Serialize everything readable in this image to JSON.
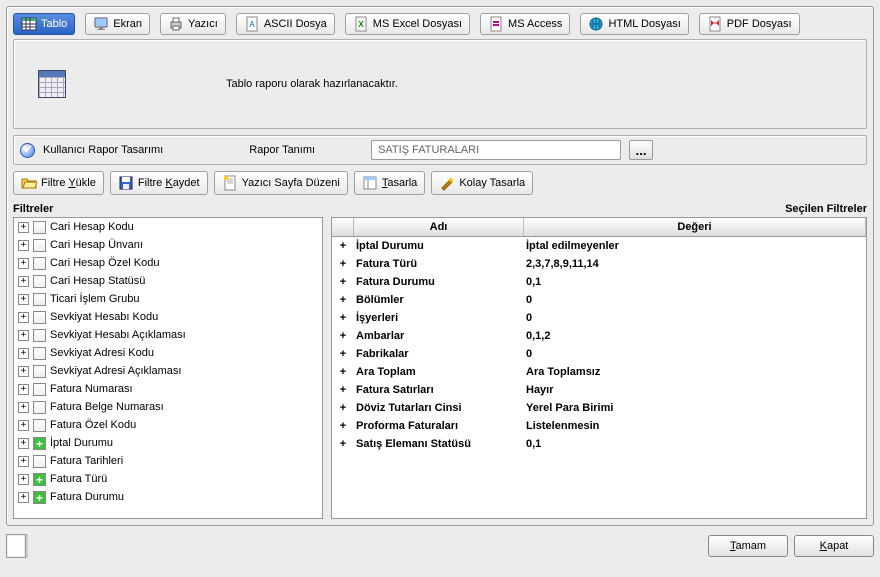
{
  "top_toolbar": [
    {
      "label": "Tablo",
      "active": true
    },
    {
      "label": "Ekran"
    },
    {
      "label": "Yazıcı"
    },
    {
      "label": "ASCII Dosya"
    },
    {
      "label": "MS Excel Dosyası"
    },
    {
      "label": "MS Access"
    },
    {
      "label": "HTML Dosyası"
    },
    {
      "label": "PDF Dosyası"
    }
  ],
  "description": "Tablo raporu olarak hazırlanacaktır.",
  "rapor": {
    "design_label": "Kullanıcı Rapor Tasarımı",
    "def_label": "Rapor Tanımı",
    "def_value": "SATIŞ FATURALARI"
  },
  "toolbar2": [
    {
      "label": "Filtre Yükle"
    },
    {
      "label": "Filtre Kaydet"
    },
    {
      "label": "Yazıcı Sayfa Düzeni"
    },
    {
      "label": "Tasarla"
    },
    {
      "label": "Kolay Tasarla"
    }
  ],
  "left_panel_title": "Filtreler",
  "right_panel_title": "Seçilen Filtreler",
  "right_header_name": "Adı",
  "right_header_val": "Değeri",
  "filters": [
    {
      "name": "Cari Hesap Kodu",
      "checked": false
    },
    {
      "name": "Cari Hesap Ünvanı",
      "checked": false
    },
    {
      "name": "Cari Hesap Özel Kodu",
      "checked": false
    },
    {
      "name": "Cari Hesap Statüsü",
      "checked": false
    },
    {
      "name": "Ticari İşlem Grubu",
      "checked": false
    },
    {
      "name": "Sevkiyat Hesabı Kodu",
      "checked": false
    },
    {
      "name": "Sevkiyat Hesabı Açıklaması",
      "checked": false
    },
    {
      "name": "Sevkiyat Adresi Kodu",
      "checked": false
    },
    {
      "name": "Sevkiyat Adresi Açıklaması",
      "checked": false
    },
    {
      "name": "Fatura Numarası",
      "checked": false
    },
    {
      "name": "Fatura Belge Numarası",
      "checked": false
    },
    {
      "name": "Fatura Özel Kodu",
      "checked": false
    },
    {
      "name": "İptal Durumu",
      "checked": true
    },
    {
      "name": "Fatura Tarihleri",
      "checked": false
    },
    {
      "name": "Fatura Türü",
      "checked": true
    },
    {
      "name": "Fatura Durumu",
      "checked": true
    }
  ],
  "selected": [
    {
      "name": "İptal Durumu",
      "value": "İptal edilmeyenler"
    },
    {
      "name": "Fatura Türü",
      "value": "2,3,7,8,9,11,14"
    },
    {
      "name": "Fatura Durumu",
      "value": "0,1"
    },
    {
      "name": "Bölümler",
      "value": "0"
    },
    {
      "name": "İşyerleri",
      "value": "0"
    },
    {
      "name": "Ambarlar",
      "value": "0,1,2"
    },
    {
      "name": "Fabrikalar",
      "value": "0"
    },
    {
      "name": "Ara Toplam",
      "value": "Ara Toplamsız"
    },
    {
      "name": "Fatura Satırları",
      "value": "Hayır"
    },
    {
      "name": "Döviz Tutarları Cinsi",
      "value": "Yerel Para Birimi"
    },
    {
      "name": "Proforma Faturaları",
      "value": "Listelenmesin"
    },
    {
      "name": "Satış Elemanı Statüsü",
      "value": "0,1"
    }
  ],
  "bottom": {
    "ok": "Tamam",
    "close": "Kapat"
  }
}
